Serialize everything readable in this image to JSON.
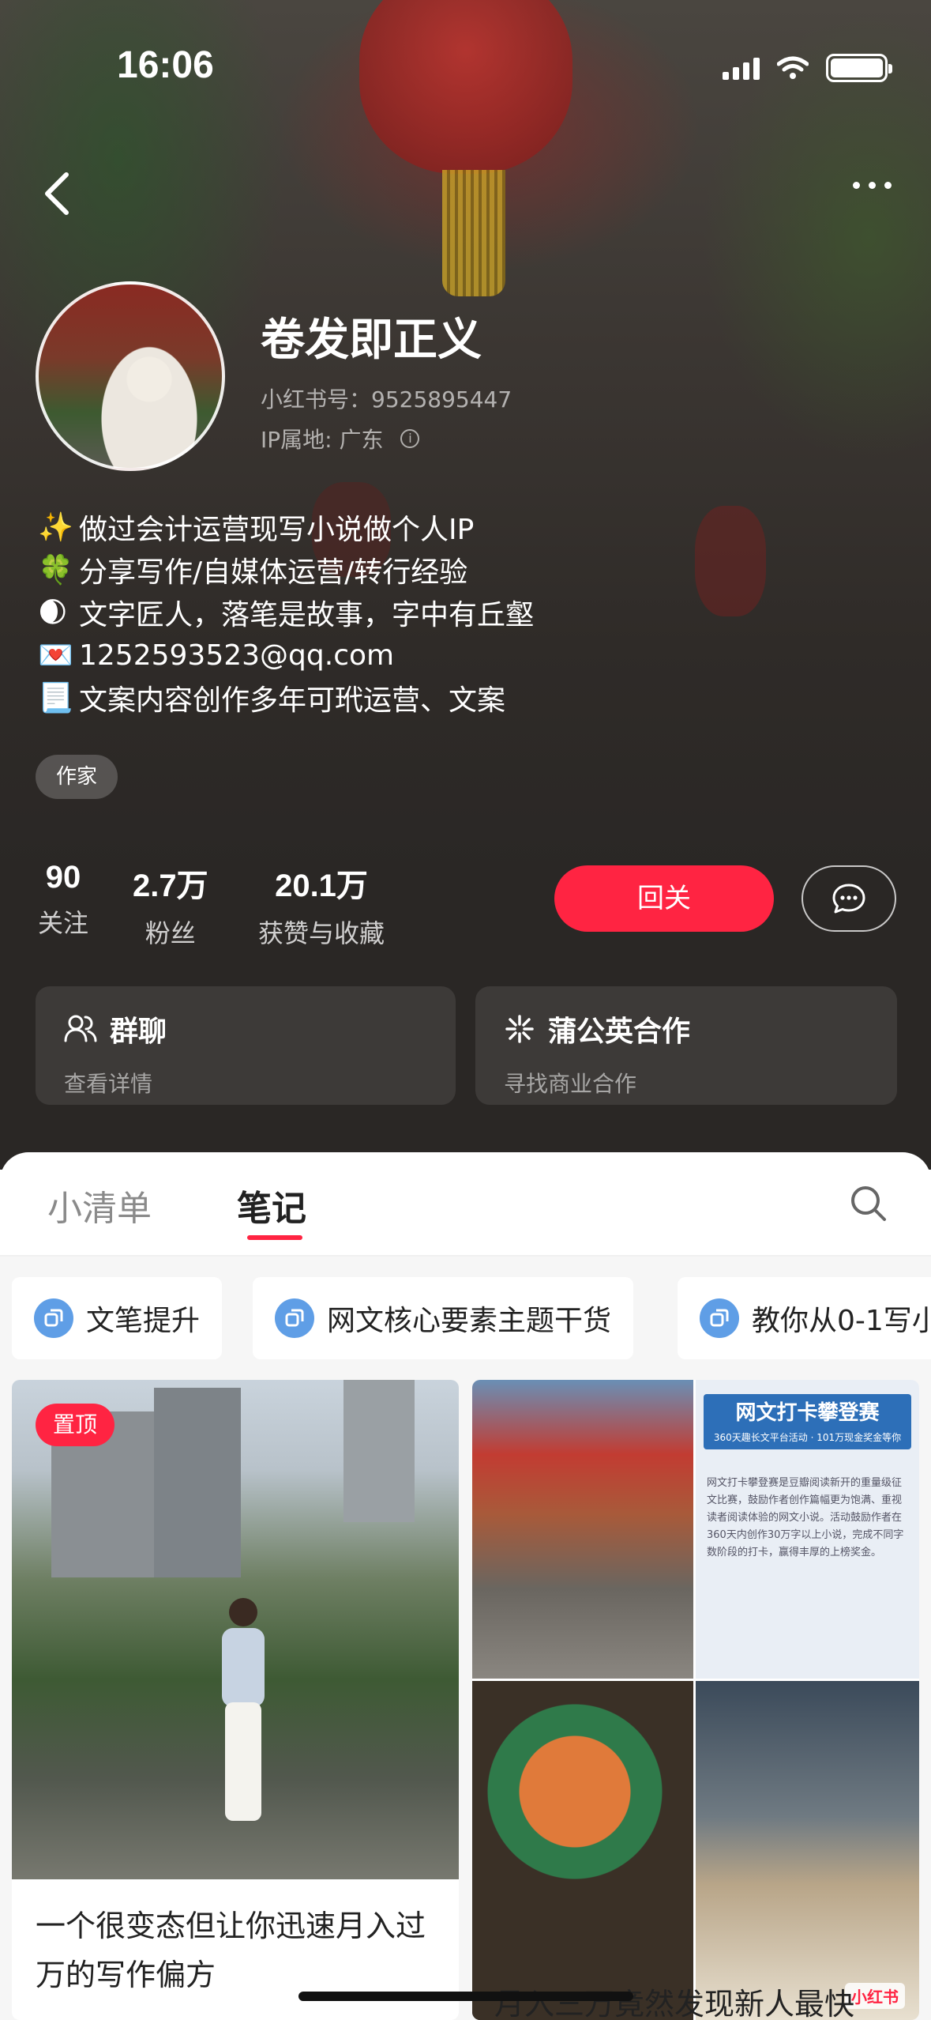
{
  "status_bar": {
    "time": "16:06"
  },
  "profile": {
    "nickname": "卷发即正义",
    "rednote_id": "小红书号：9525895447",
    "ip_location": "IP属地: 广东",
    "bio": [
      {
        "emoji": "✨",
        "text": "做过会计运营现写小说做个人IP"
      },
      {
        "emoji": "🍀",
        "text": "分享写作/自媒体运营/转行经验"
      },
      {
        "emoji": "🌒",
        "text": "文字匠人，落笔是故事，字中有丘壑"
      },
      {
        "emoji": "💌",
        "text": "1252593523@qq.com"
      },
      {
        "emoji": "📃",
        "text": "文案内容创作多年可玳运营、文案"
      }
    ],
    "tag": "作家",
    "stats": [
      {
        "num": "90",
        "label": "关注"
      },
      {
        "num": "2.7万",
        "label": "粉丝"
      },
      {
        "num": "20.1万",
        "label": "获赞与收藏"
      }
    ],
    "follow_back_label": "回关"
  },
  "cards": [
    {
      "icon": "group-chat-icon",
      "title": "群聊",
      "sub": "查看详情"
    },
    {
      "icon": "pugongying-icon",
      "title": "蒲公英合作",
      "sub": "寻找商业合作"
    }
  ],
  "tabs": [
    {
      "label": "小清单",
      "active": false
    },
    {
      "label": "笔记",
      "active": true
    }
  ],
  "collections": [
    "文笔提升",
    "网文核心要素主题干货",
    "教你从0-1写小"
  ],
  "posts": [
    {
      "pinned_label": "置顶",
      "title": "一个很变态但让你迅速月入过万的写作偏方"
    },
    {
      "banner_title": "网文打卡攀登赛",
      "banner_sub": "360天趣长文平台活动 · 101万现金奖金等你",
      "banner_body": "网文打卡攀登赛是豆瓣阅读新开的重量级征文比赛，鼓励作者创作篇幅更为饱满、重视读者阅读体验的网文小说。活动鼓励作者在360天内创作30万字以上小说，完成不同字数阶段的打卡，赢得丰厚的上榜奖金。",
      "watermark": "小红书",
      "title": "月入三万竟然发现新人最快"
    }
  ],
  "colors": {
    "accent": "#ff2442",
    "chip_icon": "#5f9ee6"
  }
}
